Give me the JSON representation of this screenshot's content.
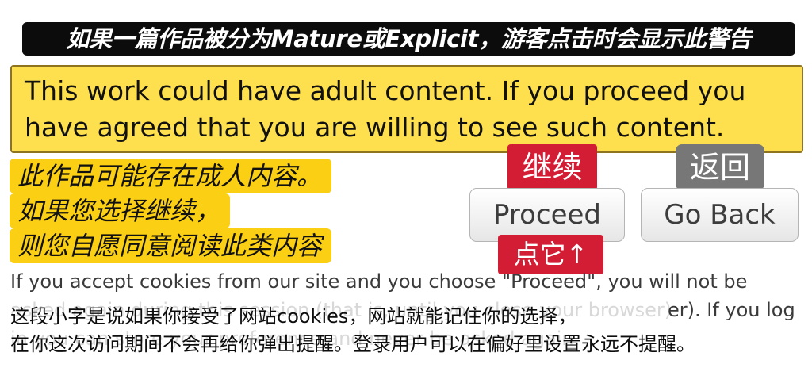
{
  "banner": {
    "text": "如果一篇作品被分为Mature或Explicit，游客点击时会显示此警告"
  },
  "warning": {
    "line1": "This work could have adult content. If you proceed you",
    "line2": "have agreed that you are willing to see such content."
  },
  "annotation_zh": {
    "line1": "此作品可能存在成人内容。",
    "line2": "如果您选择继续，",
    "line3": "则您自愿同意阅读此类内容"
  },
  "labels": {
    "continue": "继续",
    "click_it": "点它↑",
    "back": "返回"
  },
  "buttons": {
    "proceed": "Proceed",
    "go_back": "Go Back"
  },
  "cookie_notice": {
    "line1": "If you accept cookies from our site and you choose \"Proceed\", you will not be",
    "line2_partial": "asked again during this session (that is, until you close your browser)",
    "line2_end": "er). If you log",
    "line3_partial": "in you can store your preference and never be asked again."
  },
  "overlay_zh": {
    "line1": "这段小字是说如果你接受了网站cookies，网站就能记住你的选择，",
    "line2": "在你这次访问期间不会再给你弹出提醒。登录用户可以在偏好里设置永远不提醒。"
  }
}
